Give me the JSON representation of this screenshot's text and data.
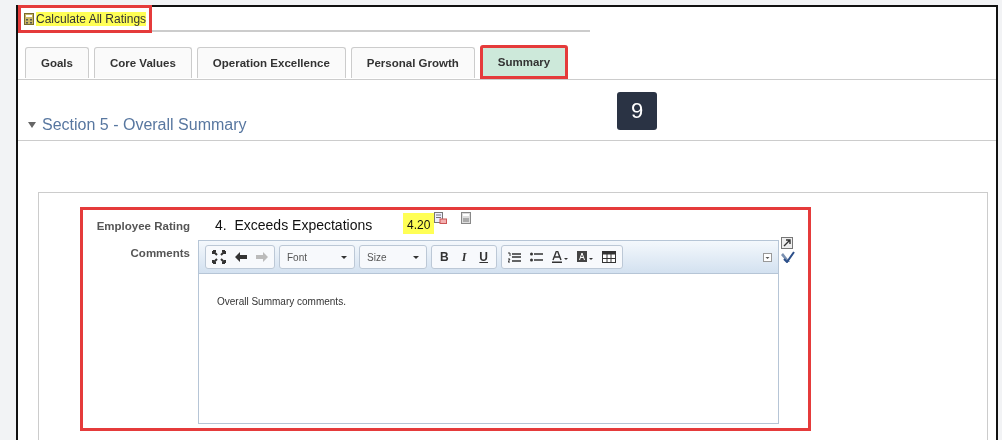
{
  "action": {
    "label": "Calculate All Ratings",
    "highlighted": true
  },
  "tabs": [
    {
      "label": "Goals",
      "selected": false
    },
    {
      "label": "Core Values",
      "selected": false
    },
    {
      "label": "Operation Excellence",
      "selected": false
    },
    {
      "label": "Personal Growth",
      "selected": false
    },
    {
      "label": "Summary",
      "selected": true
    }
  ],
  "step_badge": "9",
  "section": {
    "title": "Section 5 - Overall Summary",
    "expanded": true
  },
  "form": {
    "highlighted": true,
    "rating_label": "Employee Rating",
    "rating_value": "4.  Exceeds Expectations",
    "score": "4.20",
    "comments_label": "Comments",
    "editor": {
      "font": "Font",
      "size": "Size",
      "bold": "B",
      "italic": "I",
      "underline": "U",
      "content": "Overall Summary comments."
    }
  }
}
